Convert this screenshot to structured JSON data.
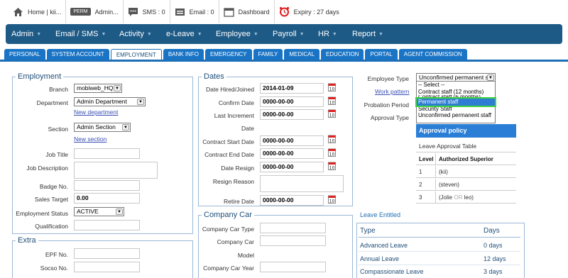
{
  "topbar": {
    "home_label": "Home | kii...",
    "perm_badge": "PERM",
    "user_label": "Admin...",
    "sms_label": "SMS : 0",
    "email_label": "Email : 0",
    "dashboard_label": "Dashboard",
    "expiry_label": "Expiry : 27 days"
  },
  "nav": [
    "Admin",
    "Email / SMS",
    "Activity",
    "e-Leave",
    "Employee",
    "Payroll",
    "HR",
    "Report"
  ],
  "tabs": [
    "PERSONAL",
    "SYSTEM ACCOUNT",
    "EMPLOYMENT",
    "BANK INFO",
    "EMERGENCY",
    "FAMILY",
    "MEDICAL",
    "EDUCATION",
    "PORTAL",
    "AGENT COMMISSION"
  ],
  "active_tab": "EMPLOYMENT",
  "employment": {
    "title": "Employment",
    "branch_label": "Branch",
    "branch_value": "mobiweb_HQ",
    "department_label": "Department",
    "department_value": "Admin Department",
    "new_department_link": "New department",
    "section_label": "Section",
    "section_value": "Admin Section",
    "new_section_link": "New section",
    "job_title_label": "Job Title",
    "job_title_value": "",
    "job_description_label": "Job Description",
    "job_description_value": "",
    "badge_label": "Badge No.",
    "badge_value": "",
    "sales_target_label": "Sales Target",
    "sales_target_value": "0.00",
    "status_label": "Employment Status",
    "status_value": "ACTIVE",
    "qualification_label": "Qualification",
    "qualification_value": ""
  },
  "extra": {
    "title": "Extra",
    "epf_label": "EPF No.",
    "epf_value": "",
    "socso_label": "Socso No.",
    "socso_value": ""
  },
  "dates": {
    "title": "Dates",
    "hired_label": "Date Hired/Joined",
    "hired_value": "2014-01-09",
    "confirm_label": "Confirm Date",
    "confirm_value": "0000-00-00",
    "last_increment_label": "Last Increment",
    "last_increment_label2": "Date",
    "last_increment_value": "0000-00-00",
    "contract_start_label": "Contract Start Date",
    "contract_start_value": "0000-00-00",
    "contract_end_label": "Contract End Date",
    "contract_end_value": "0000-00-00",
    "resign_label": "Date Resign",
    "resign_value": "0000-00-00",
    "resign_reason_label": "Resign Reason",
    "resign_reason_value": "",
    "retire_label": "Retire Date",
    "retire_value": "0000-00-00"
  },
  "company_car": {
    "title": "Company Car",
    "type_label": "Company Car Type",
    "type_value": "",
    "model_label": "Company Car",
    "model_label2": "Model",
    "model_value": "",
    "year_label": "Company Car Year",
    "year_value": ""
  },
  "right": {
    "employee_type_label": "Employee Type",
    "employee_type_value": "Unconfirmed permanent s",
    "work_pattern_link": "Work pattern",
    "probation_label": "Probation Period",
    "approval_type_label": "Approval Type",
    "employee_type_options": [
      "-- Select --",
      "Contract staff (12 months)",
      "Contract staff (6 months)",
      "Permanent staff",
      "Security Staff",
      "Unconfirmed permanent staff"
    ],
    "highlighted_option": "Permanent staff"
  },
  "approval": {
    "title": "Approval policy",
    "caption": "Leave Approval Table",
    "col_level": "Level",
    "col_superior": "Authorized Superior",
    "rows": [
      {
        "level": "1",
        "superior": "(kii)"
      },
      {
        "level": "2",
        "superior": "(steven)"
      },
      {
        "level": "3",
        "superior_a": "(Jolie",
        "or": "OR",
        "superior_b": "leo)"
      }
    ]
  },
  "leave": {
    "title": "Leave Entitled",
    "col_type": "Type",
    "col_days": "Days",
    "rows": [
      {
        "type": "Advanced Leave",
        "days": "0 days"
      },
      {
        "type": "Annual Leave",
        "days": "12 days"
      },
      {
        "type": "Compassionate Leave",
        "days": "3 days"
      }
    ]
  },
  "colors": {
    "nav_bg": "#1e5a86",
    "tab_bg": "#1a74c5",
    "legend_text": "#1f4e79",
    "highlight_outline": "#3ed43e"
  }
}
